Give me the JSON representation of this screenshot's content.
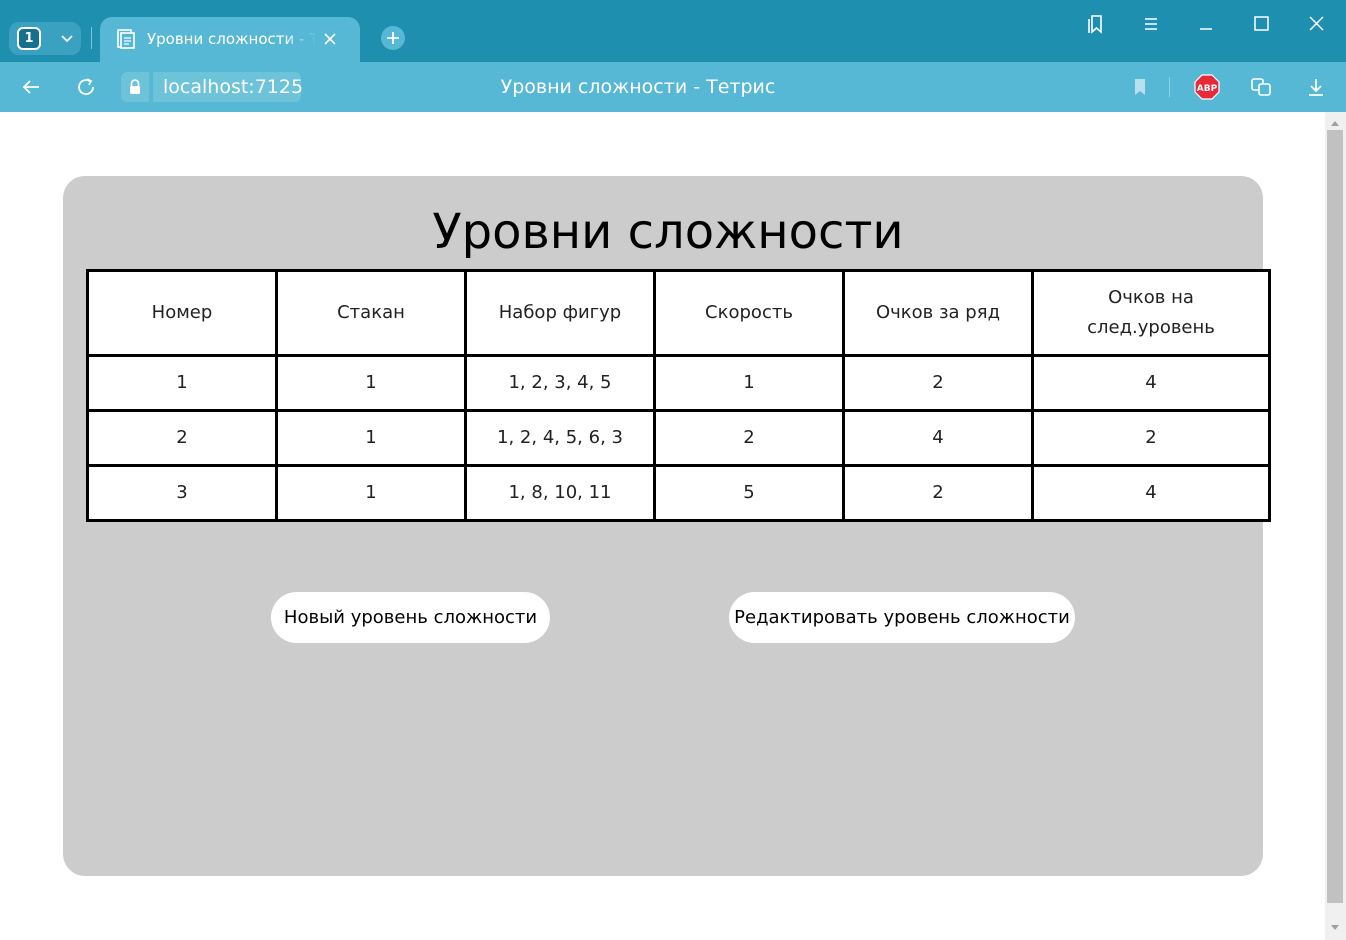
{
  "browser": {
    "tab_count": "1",
    "tab_title": "Уровни сложности - Тетрис",
    "url": "localhost:7125",
    "page_title": "Уровни сложности - Тетрис",
    "abp_label": "ABP",
    "icons": [
      "chevron-down-icon",
      "document-icon",
      "close-icon",
      "plus-icon",
      "bookmarks-icon",
      "menu-icon",
      "minimize-icon",
      "maximize-icon",
      "close-window-icon",
      "back-icon",
      "reload-icon",
      "lock-icon",
      "bookmark-icon",
      "adblock-icon",
      "translate-icon",
      "download-icon"
    ],
    "colors": {
      "tabbar": "#1f8fb0",
      "addressbar": "#56b8d4"
    }
  },
  "page": {
    "heading": "Уровни сложности",
    "table": {
      "headers": [
        "Номер",
        "Стакан",
        "Набор фигур",
        "Скорость",
        "Очков за ряд",
        "Очков на след.уровень"
      ],
      "rows": [
        [
          "1",
          "1",
          "1, 2, 3, 4, 5",
          "1",
          "2",
          "4"
        ],
        [
          "2",
          "1",
          "1, 2, 4, 5, 6, 3",
          "2",
          "4",
          "2"
        ],
        [
          "3",
          "1",
          "1, 8, 10, 11",
          "5",
          "2",
          "4"
        ]
      ]
    },
    "buttons": {
      "new": "Новый уровень сложности",
      "edit": "Редактировать уровень сложности"
    },
    "colors": {
      "panel": "#cccccc"
    }
  }
}
